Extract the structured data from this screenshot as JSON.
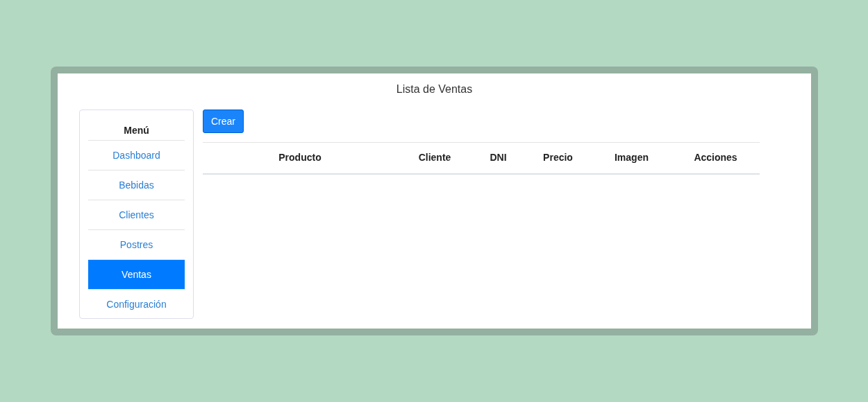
{
  "title": "Lista de Ventas",
  "sidebar": {
    "heading": "Menú",
    "items": [
      {
        "label": "Dashboard",
        "selected": false
      },
      {
        "label": "Bebidas",
        "selected": false
      },
      {
        "label": "Clientes",
        "selected": false
      },
      {
        "label": "Postres",
        "selected": false
      },
      {
        "label": "Ventas",
        "selected": true
      },
      {
        "label": "Configuración",
        "selected": false
      }
    ]
  },
  "create_button": "Crear",
  "table": {
    "columns": [
      "Producto",
      "Cliente",
      "DNI",
      "Precio",
      "Imagen",
      "Acciones"
    ]
  }
}
